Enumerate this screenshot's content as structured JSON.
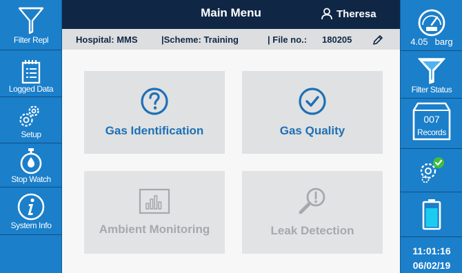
{
  "header": {
    "title": "Main Menu",
    "user": "Theresa"
  },
  "info": {
    "hospital": "Hospital: MMS",
    "scheme": "|Scheme: Training",
    "file": "| File no.:",
    "file_no": "180205"
  },
  "left_sidebar": {
    "filter_repl": "Filter Repl",
    "logged_data": "Logged Data",
    "setup": "Setup",
    "stop_watch": "Stop Watch",
    "system_info": "System Info"
  },
  "right_sidebar": {
    "pressure_value": "4.05",
    "pressure_unit": "barg",
    "filter_status": "Filter Status",
    "records_count": "007",
    "records": "Records",
    "time": "11:01:16",
    "date": "06/02/19"
  },
  "tiles": {
    "gas_identification": "Gas Identification",
    "gas_quality": "Gas Quality",
    "ambient_monitoring": "Ambient Monitoring",
    "leak_detection": "Leak Detection"
  },
  "colors": {
    "sidebar": "#1B7FCA",
    "header": "#0F2745",
    "accent": "#1E6FB5",
    "disabled_text": "#A5A9AD",
    "ok_green": "#3DBE3D"
  }
}
